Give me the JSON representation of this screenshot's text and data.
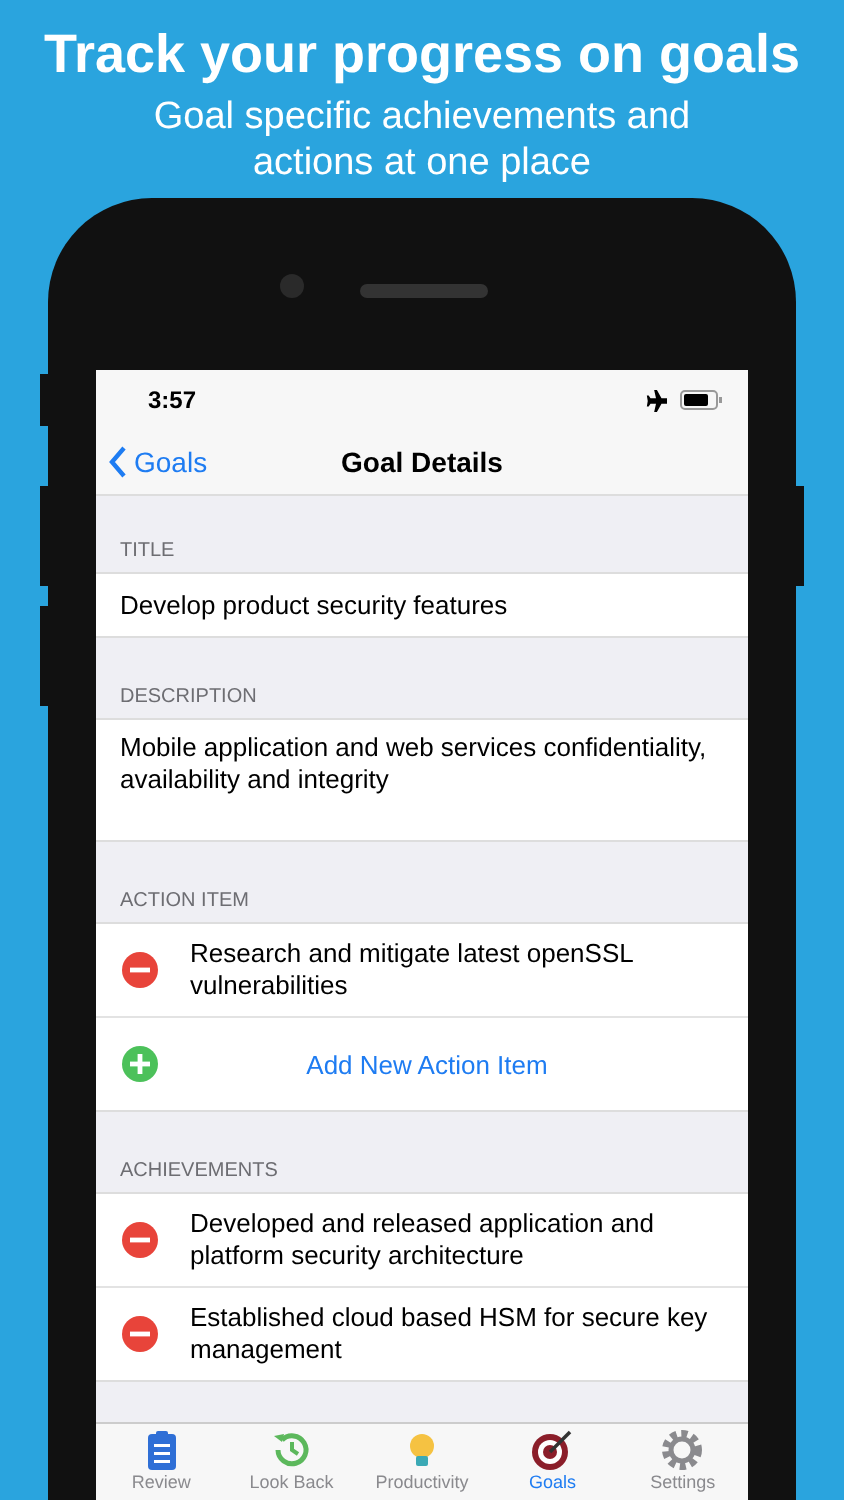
{
  "headline": "Track your progress on goals",
  "subheadline": "Goal specific achievements and actions at one place",
  "status_bar": {
    "time": "3:57"
  },
  "nav": {
    "back": "Goals",
    "title": "Goal Details"
  },
  "sections": [
    {
      "header": "TITLE",
      "kind": "text",
      "value": "Develop product security features"
    },
    {
      "header": "DESCRIPTION",
      "kind": "textarea",
      "value": "Mobile application and web services confidentiality, availability and integrity"
    },
    {
      "header": "ACTION ITEM",
      "kind": "list",
      "rows": [
        {
          "kind": "remove",
          "text": "Research and mitigate latest openSSL vulnerabilities"
        },
        {
          "kind": "add",
          "text": "Add New Action Item"
        }
      ]
    },
    {
      "header": "ACHIEVEMENTS",
      "kind": "list",
      "rows": [
        {
          "kind": "remove",
          "text": "Developed and released application and platform security architecture"
        },
        {
          "kind": "remove",
          "text": "Established cloud based HSM for secure key management"
        }
      ]
    }
  ],
  "tabs": [
    {
      "label": "Review",
      "kind": "clipboard",
      "selected": false
    },
    {
      "label": "Look Back",
      "kind": "history",
      "selected": false
    },
    {
      "label": "Productivity",
      "kind": "bulb",
      "selected": false
    },
    {
      "label": "Goals",
      "kind": "target",
      "selected": true
    },
    {
      "label": "Settings",
      "kind": "gear",
      "selected": false
    }
  ]
}
